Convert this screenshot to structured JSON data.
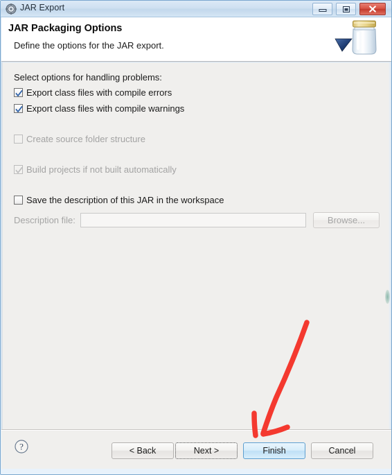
{
  "window": {
    "title": "JAR Export",
    "title_icon": "jar-export-gear-icon",
    "controls": {
      "minimize": "minimize-icon",
      "maximize": "maximize-icon",
      "close": "close-icon"
    }
  },
  "header": {
    "title": "JAR Packaging Options",
    "description": "Define the options for the JAR export.",
    "icon": "jar-banner-icon"
  },
  "content": {
    "intro_label": "Select options for handling problems:",
    "options": [
      {
        "label": "Export class files with compile errors",
        "checked": true,
        "enabled": true
      },
      {
        "label": "Export class files with compile warnings",
        "checked": true,
        "enabled": true
      },
      {
        "label": "Create source folder structure",
        "checked": false,
        "enabled": false
      },
      {
        "label": "Build projects if not built automatically",
        "checked": true,
        "enabled": false
      },
      {
        "label": "Save the description of this JAR in the workspace",
        "checked": false,
        "enabled": true
      }
    ],
    "description_file": {
      "label": "Description file:",
      "value": "",
      "placeholder": "",
      "browse_label": "Browse..."
    }
  },
  "footer": {
    "help_icon": "help-question-icon",
    "buttons": [
      {
        "label": "< Back",
        "name": "back-button",
        "state": "enabled"
      },
      {
        "label": "Next >",
        "name": "next-button",
        "state": "focused"
      },
      {
        "label": "Finish",
        "name": "finish-button",
        "state": "default"
      },
      {
        "label": "Cancel",
        "name": "cancel-button",
        "state": "enabled"
      }
    ]
  },
  "annotation": {
    "type": "hand-drawn-arrow",
    "color": "#f4392f",
    "points_to": "finish-button"
  },
  "colors": {
    "dialog_background": "#f0efed",
    "header_background": "#ffffff",
    "frame_border": "#7ba7ce",
    "default_button": "#cfe7f8",
    "close_button": "#cf4131",
    "annotation_red": "#f4392f"
  }
}
